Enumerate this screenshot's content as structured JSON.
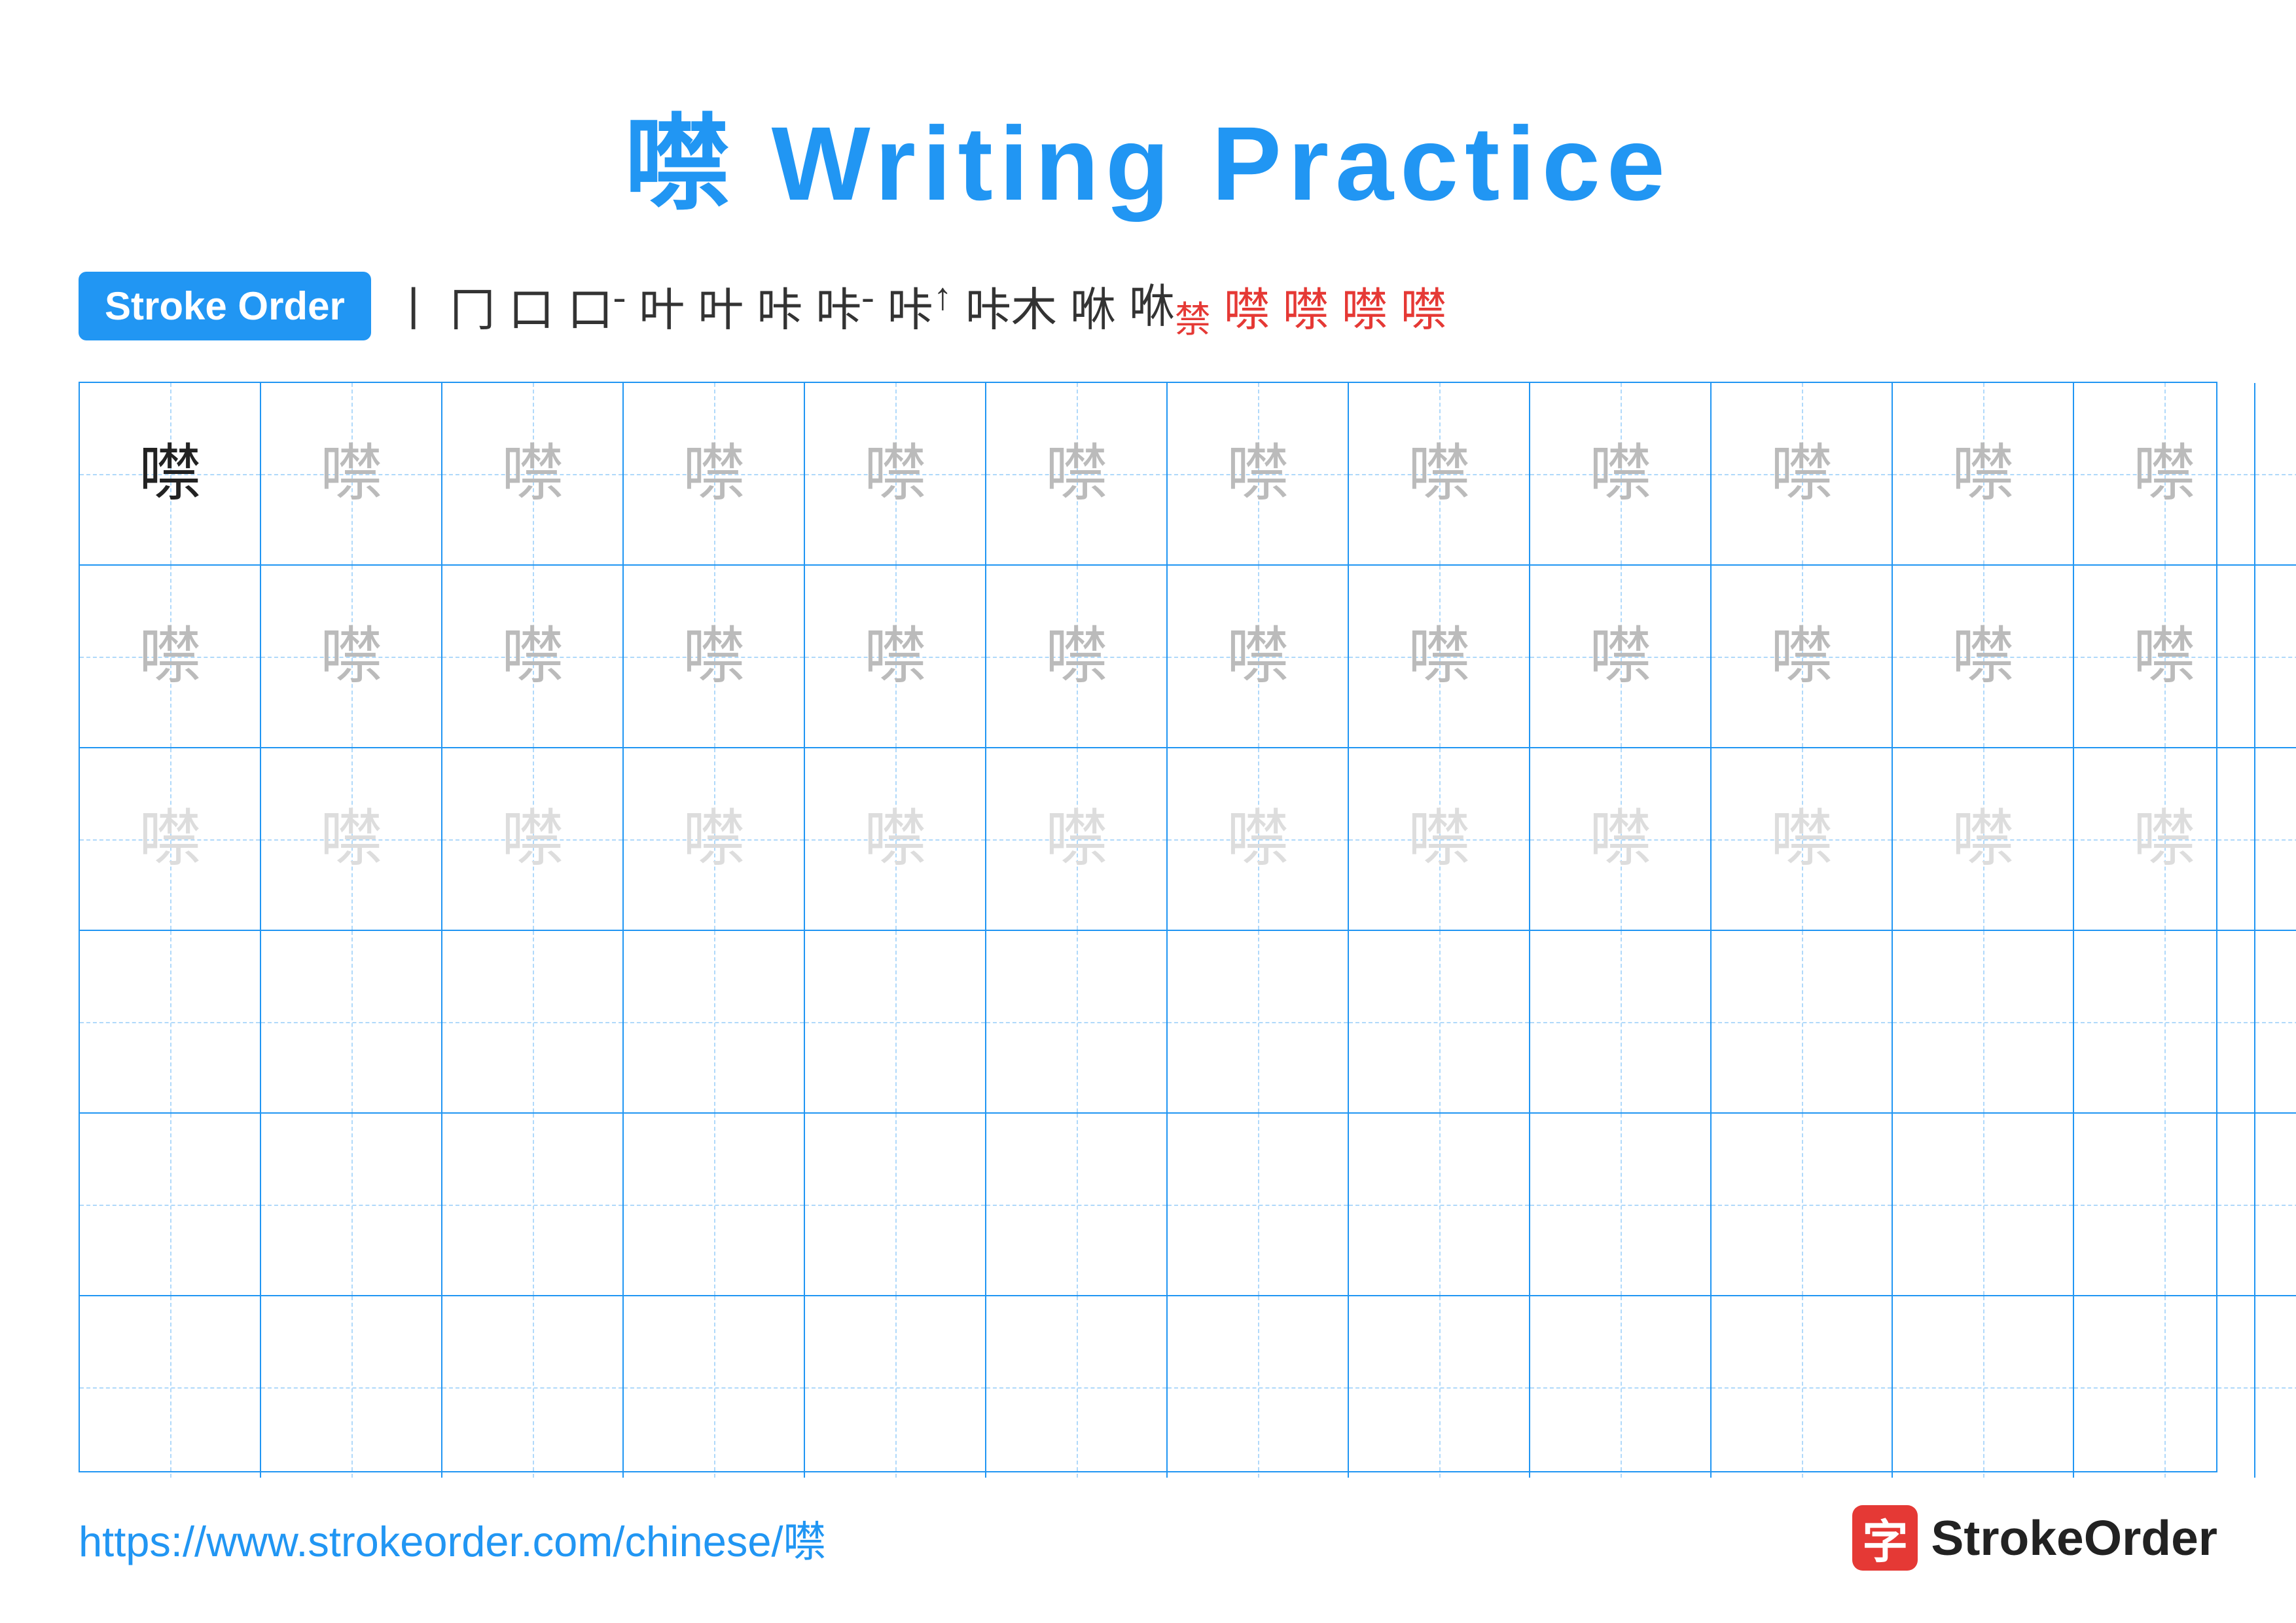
{
  "title": {
    "char": "噤",
    "suffix": " Writing Practice"
  },
  "stroke_order": {
    "badge_label": "Stroke Order",
    "steps": [
      "丨",
      "冂",
      "口",
      "口⁻",
      "叶",
      "叶",
      "咔",
      "咔⁻",
      "咔↑",
      "咔木",
      "咻",
      "咻禁",
      "噤禁",
      "噤禁",
      "噤禁",
      "噤"
    ]
  },
  "grid": {
    "rows": 6,
    "cols": 13,
    "char": "噤",
    "row1_style": [
      "dark",
      "medium",
      "medium",
      "medium",
      "medium",
      "medium",
      "medium",
      "medium",
      "medium",
      "medium",
      "medium",
      "medium",
      "medium"
    ],
    "row2_style": [
      "medium",
      "medium",
      "medium",
      "medium",
      "medium",
      "medium",
      "medium",
      "medium",
      "medium",
      "medium",
      "medium",
      "medium",
      "medium"
    ],
    "row3_style": [
      "light",
      "light",
      "light",
      "light",
      "light",
      "light",
      "light",
      "light",
      "light",
      "light",
      "light",
      "light",
      "light"
    ]
  },
  "footer": {
    "url": "https://www.strokeorder.com/chinese/噤",
    "logo_char": "字",
    "logo_name": "StrokeOrder"
  }
}
